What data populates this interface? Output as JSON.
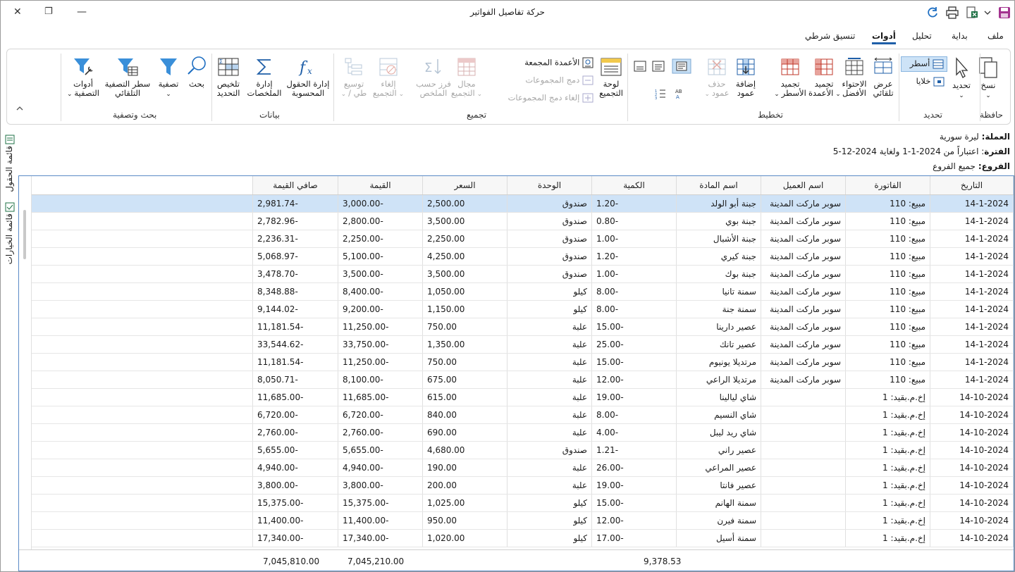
{
  "window": {
    "title": "حركة تفاصيل الفواتير",
    "close_glyph": "✕",
    "restore_glyph": "❐",
    "minimize_glyph": "—"
  },
  "menu": [
    "ملف",
    "بداية",
    "تحليل",
    "أدوات",
    "تنسيق شرطي"
  ],
  "menu_active": "أدوات",
  "ribbon": {
    "clipboard": {
      "label": "حافظة",
      "copy": "نسخ"
    },
    "selection": {
      "label": "تحديد",
      "select": "تحديد",
      "rows": "أسطر",
      "cells": "خلايا"
    },
    "layout": {
      "label": "تخطيط",
      "auto_width": [
        "عرض",
        "تلقائي"
      ],
      "best_fit": [
        "الاحتواء",
        "الأفضل"
      ],
      "freeze_cols": [
        "تجميد",
        "الأعمدة"
      ],
      "freeze_rows": [
        "تجميد",
        "الأسطر"
      ],
      "add_col": [
        "إضافة",
        "عمود"
      ],
      "del_col": [
        "حذف",
        "عمود"
      ]
    },
    "grouping": {
      "label": "تجميع",
      "panel": [
        "لوحة",
        "التجميع"
      ],
      "grouped_cols": "الأعمدة المجمعة",
      "merge": "دمج المجموعات",
      "unmerge": "إلغاء دمج المجموعات",
      "range": [
        "مجال",
        "التجميع"
      ],
      "sort_summary": [
        "فرز حسب",
        "الملخص"
      ],
      "ungroup": [
        "إلغاء",
        "التجميع"
      ],
      "expand": [
        "توسيع",
        "/ طي"
      ]
    },
    "data": {
      "label": "بيانات",
      "computed": [
        "إدارة الحقول",
        "المحسوبة"
      ],
      "summaries": [
        "إدارة",
        "الملخصات"
      ],
      "sel_summary": [
        "تلخيص",
        "التحديد"
      ]
    },
    "search": {
      "label": "بحث وتصفية",
      "find": "بحث",
      "filter": "تصفية",
      "autofilter": [
        "سطر التصفية",
        "التلقائي"
      ],
      "filter_tools": [
        "أدوات",
        "التصفية"
      ]
    }
  },
  "info": {
    "currency_label": "العملة:",
    "currency": "ليرة سورية",
    "period_label": "الفترة",
    "period": ": اعتباراً من 2024-1-1 ولغاية 2024-12-5",
    "branches_label": "الفروع:",
    "branches": "جميع الفروع"
  },
  "side_tabs": [
    "قائمة الحقول",
    "قائمة الخيارات"
  ],
  "table": {
    "columns": [
      "التاريخ",
      "الفاتورة",
      "اسم العميل",
      "اسم المادة",
      "الكمية",
      "الوحدة",
      "السعر",
      "القيمة",
      "صافي القيمة"
    ],
    "rows": [
      [
        "14-1-2024",
        "مبيع: 110",
        "سوبر ماركت المدينة",
        "جبنة أبو الولد",
        "-1.20",
        "صندوق",
        "2,500.00",
        "-3,000.00",
        "-2,981.74"
      ],
      [
        "14-1-2024",
        "مبيع: 110",
        "سوبر ماركت المدينة",
        "جبنة بوي",
        "-0.80",
        "صندوق",
        "3,500.00",
        "-2,800.00",
        "-2,782.96"
      ],
      [
        "14-1-2024",
        "مبيع: 110",
        "سوبر ماركت المدينة",
        "جبنة الأشبال",
        "-1.00",
        "صندوق",
        "2,250.00",
        "-2,250.00",
        "-2,236.31"
      ],
      [
        "14-1-2024",
        "مبيع: 110",
        "سوبر ماركت المدينة",
        "جبنة كيري",
        "-1.20",
        "صندوق",
        "4,250.00",
        "-5,100.00",
        "-5,068.97"
      ],
      [
        "14-1-2024",
        "مبيع: 110",
        "سوبر ماركت المدينة",
        "جبنة بوك",
        "-1.00",
        "صندوق",
        "3,500.00",
        "-3,500.00",
        "-3,478.70"
      ],
      [
        "14-1-2024",
        "مبيع: 110",
        "سوبر ماركت المدينة",
        "سمنة تانيا",
        "-8.00",
        "كيلو",
        "1,050.00",
        "-8,400.00",
        "-8,348.88"
      ],
      [
        "14-1-2024",
        "مبيع: 110",
        "سوبر ماركت المدينة",
        "سمنة جنة",
        "-8.00",
        "كيلو",
        "1,150.00",
        "-9,200.00",
        "-9,144.02"
      ],
      [
        "14-1-2024",
        "مبيع: 110",
        "سوبر ماركت المدينة",
        "عصير دارينا",
        "-15.00",
        "علبة",
        "750.00",
        "-11,250.00",
        "-11,181.54"
      ],
      [
        "14-1-2024",
        "مبيع: 110",
        "سوبر ماركت المدينة",
        "عصير تانك",
        "-25.00",
        "علبة",
        "1,350.00",
        "-33,750.00",
        "-33,544.62"
      ],
      [
        "14-1-2024",
        "مبيع: 110",
        "سوبر ماركت المدينة",
        "مرتديلا يونيوم",
        "-15.00",
        "علبة",
        "750.00",
        "-11,250.00",
        "-11,181.54"
      ],
      [
        "14-1-2024",
        "مبيع: 110",
        "سوبر ماركت المدينة",
        "مرتديلا الراعي",
        "-12.00",
        "علبة",
        "675.00",
        "-8,100.00",
        "-8,050.71"
      ],
      [
        "14-10-2024",
        "إخ.م.بقيد: 1",
        "",
        "شاي ليالينا",
        "-19.00",
        "علبة",
        "615.00",
        "-11,685.00",
        "-11,685.00"
      ],
      [
        "14-10-2024",
        "إخ.م.بقيد: 1",
        "",
        "شاي النسيم",
        "-8.00",
        "علبة",
        "840.00",
        "-6,720.00",
        "-6,720.00"
      ],
      [
        "14-10-2024",
        "إخ.م.بقيد: 1",
        "",
        "شاي ريد ليبل",
        "-4.00",
        "علبة",
        "690.00",
        "-2,760.00",
        "-2,760.00"
      ],
      [
        "14-10-2024",
        "إخ.م.بقيد: 1",
        "",
        "عصير راني",
        "-1.21",
        "صندوق",
        "4,680.00",
        "-5,655.00",
        "-5,655.00"
      ],
      [
        "14-10-2024",
        "إخ.م.بقيد: 1",
        "",
        "عصير المراعي",
        "-26.00",
        "علبة",
        "190.00",
        "-4,940.00",
        "-4,940.00"
      ],
      [
        "14-10-2024",
        "إخ.م.بقيد: 1",
        "",
        "عصير فانتا",
        "-19.00",
        "علبة",
        "200.00",
        "-3,800.00",
        "-3,800.00"
      ],
      [
        "14-10-2024",
        "إخ.م.بقيد: 1",
        "",
        "سمنة الهانم",
        "-15.00",
        "كيلو",
        "1,025.00",
        "-15,375.00",
        "-15,375.00"
      ],
      [
        "14-10-2024",
        "إخ.م.بقيد: 1",
        "",
        "سمنة فيرن",
        "-12.00",
        "كيلو",
        "950.00",
        "-11,400.00",
        "-11,400.00"
      ],
      [
        "14-10-2024",
        "إخ.م.بقيد: 1",
        "",
        "سمنة أسيل",
        "-17.00",
        "كيلو",
        "1,020.00",
        "-17,340.00",
        "-17,340.00"
      ]
    ],
    "selected_row": 0,
    "footer": {
      "quantity_total": "9,378.53",
      "value_total": "7,045,210.00",
      "net_total": "7,045,810.00"
    }
  },
  "colors": {
    "accent": "#1f5fa8",
    "selection": "#cfe3f7",
    "grid_border": "#5a8ac6"
  }
}
